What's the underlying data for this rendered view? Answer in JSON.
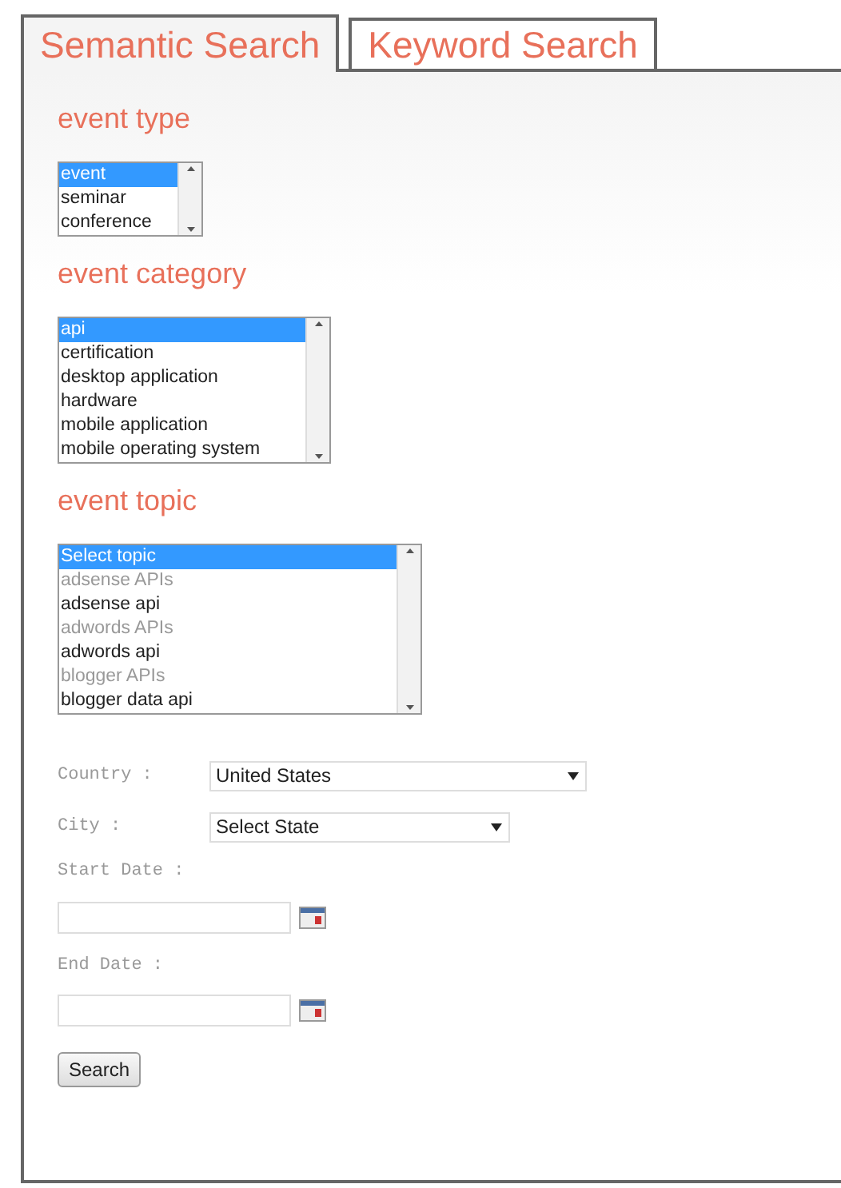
{
  "tabs": [
    {
      "label": "Semantic Search",
      "selected": true
    },
    {
      "label": "Keyword Search",
      "selected": false
    }
  ],
  "event_type": {
    "heading": "event type",
    "options": [
      {
        "label": "event",
        "selected": true
      },
      {
        "label": "seminar",
        "selected": false
      },
      {
        "label": "conference",
        "selected": false
      }
    ]
  },
  "event_category": {
    "heading": "event category",
    "options": [
      {
        "label": "api",
        "selected": true
      },
      {
        "label": "certification",
        "selected": false
      },
      {
        "label": "desktop application",
        "selected": false
      },
      {
        "label": "hardware",
        "selected": false
      },
      {
        "label": "mobile application",
        "selected": false
      },
      {
        "label": "mobile operating system",
        "selected": false
      }
    ]
  },
  "event_topic": {
    "heading": "event topic",
    "options": [
      {
        "label": "Select topic",
        "selected": true,
        "disabled": false
      },
      {
        "label": "adsense APIs",
        "selected": false,
        "disabled": true
      },
      {
        "label": "adsense api",
        "selected": false,
        "disabled": false
      },
      {
        "label": "adwords APIs",
        "selected": false,
        "disabled": true
      },
      {
        "label": "adwords api",
        "selected": false,
        "disabled": false
      },
      {
        "label": "blogger APIs",
        "selected": false,
        "disabled": true
      },
      {
        "label": "blogger data api",
        "selected": false,
        "disabled": false
      }
    ]
  },
  "country": {
    "label": "Country :",
    "value": "United States"
  },
  "city": {
    "label": "City :",
    "value": "Select State"
  },
  "start_date": {
    "label": "Start Date :"
  },
  "end_date": {
    "label": "End Date :"
  },
  "search_button": "Search"
}
